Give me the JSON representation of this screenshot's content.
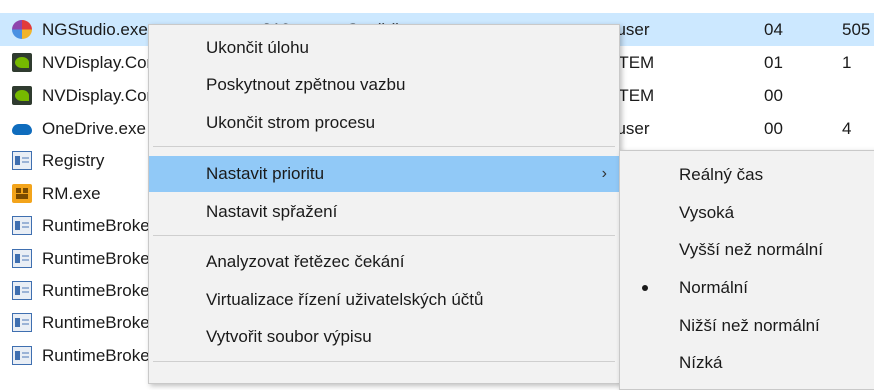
{
  "processes": [
    {
      "name": "NGStudio.exe",
      "pid": "312",
      "status": "Spuštěno",
      "user": "puser",
      "cpu": "04",
      "mem": "505",
      "icon": "ngstudio-icon",
      "selected": true
    },
    {
      "name": "NVDisplay.Container.exe",
      "user": "STEM",
      "cpu": "01",
      "mem": "1",
      "icon": "nvidia-icon"
    },
    {
      "name": "NVDisplay.Container.exe",
      "user": "STEM",
      "cpu": "00",
      "icon": "nvidia-icon"
    },
    {
      "name": "OneDrive.exe",
      "user": "puser",
      "cpu": "00",
      "mem": "4",
      "icon": "onedrive-icon"
    },
    {
      "name": "Registry",
      "icon": "process-icon"
    },
    {
      "name": "RM.exe",
      "icon": "rm-icon"
    },
    {
      "name": "RuntimeBroker.exe",
      "icon": "process-icon"
    },
    {
      "name": "RuntimeBroker.exe",
      "icon": "process-icon"
    },
    {
      "name": "RuntimeBroker.exe",
      "icon": "process-icon"
    },
    {
      "name": "RuntimeBroker.exe",
      "icon": "process-icon"
    },
    {
      "name": "RuntimeBroker.exe",
      "icon": "process-icon"
    }
  ],
  "context_menu": {
    "end_task": "Ukončit úlohu",
    "feedback": "Poskytnout zpětnou vazbu",
    "end_tree": "Ukončit strom procesu",
    "set_priority": "Nastavit prioritu",
    "set_affinity": "Nastavit spřažení",
    "analyze_wait": "Analyzovat řetězec čekání",
    "uac_virtualization": "Virtualizace řízení uživatelských účtů",
    "create_dump": "Vytvořit soubor výpisu",
    "submenu_arrow": "›"
  },
  "priority_menu": {
    "realtime": "Reálný čas",
    "high": "Vysoká",
    "above_normal": "Vyšší než normální",
    "normal": "Normální",
    "below_normal": "Nižší než normální",
    "low": "Nízká",
    "selected": "normal"
  },
  "colors": {
    "selected_row": "#cce8ff",
    "menu_hover": "#91c9f7",
    "menu_bg": "#f2f2f2"
  }
}
